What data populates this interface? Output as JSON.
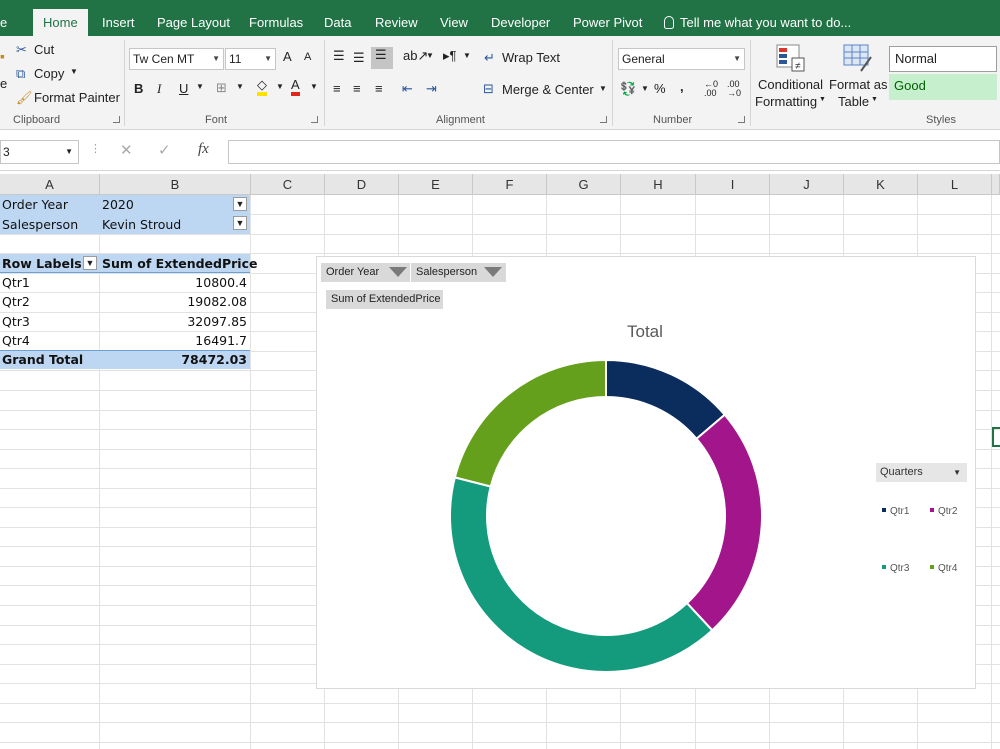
{
  "ribbon": {
    "tabs": [
      "e",
      "Home",
      "Insert",
      "Page Layout",
      "Formulas",
      "Data",
      "Review",
      "View",
      "Developer",
      "Power Pivot"
    ],
    "tell_me": "Tell me what you want to do...",
    "clipboard": {
      "cut": "Cut",
      "copy": "Copy",
      "format_painter": "Format Painter",
      "group": "Clipboard",
      "paste_fragment": "e"
    },
    "font": {
      "name": "Tw Cen MT",
      "size": "11",
      "bold": "B",
      "italic": "I",
      "underline": "U",
      "grow": "A",
      "shrink": "A",
      "font_color": "A",
      "group": "Font"
    },
    "alignment": {
      "wrap": "Wrap Text",
      "merge": "Merge & Center",
      "group": "Alignment"
    },
    "number": {
      "format": "General",
      "percent": "%",
      "comma": ",",
      "group": "Number"
    },
    "styles": {
      "conditional_l1": "Conditional",
      "conditional_l2": "Formatting",
      "format_table_l1": "Format as",
      "format_table_l2": "Table",
      "normal": "Normal",
      "good": "Good",
      "group": "Styles"
    }
  },
  "formula_bar": {
    "name_box": "3",
    "fx": "fx"
  },
  "columns": [
    "A",
    "B",
    "C",
    "D",
    "E",
    "F",
    "G",
    "H",
    "I",
    "J",
    "K",
    "L"
  ],
  "pivot": {
    "filters": [
      {
        "label": "Order Year",
        "value": "2020"
      },
      {
        "label": "Salesperson",
        "value": "Kevin Stroud"
      }
    ],
    "header_labels": "Row Labels",
    "header_sum": "Sum of ExtendedPrice",
    "rows": [
      {
        "label": "Qtr1",
        "value": "10800.4"
      },
      {
        "label": "Qtr2",
        "value": "19082.08"
      },
      {
        "label": "Qtr3",
        "value": "32097.85"
      },
      {
        "label": "Qtr4",
        "value": "16491.7"
      }
    ],
    "total_label": "Grand Total",
    "total_value": "78472.03"
  },
  "chart_buttons": {
    "order_year": "Order Year",
    "salesperson": "Salesperson",
    "sum_field": "Sum of ExtendedPrice",
    "legend_field": "Quarters"
  },
  "chart_data": {
    "type": "pie",
    "variant": "doughnut",
    "title": "Total",
    "categories": [
      "Qtr1",
      "Qtr2",
      "Qtr3",
      "Qtr4"
    ],
    "values": [
      10800.4,
      19082.08,
      32097.85,
      16491.7
    ],
    "colors": [
      "#0b2d5e",
      "#a3158b",
      "#149a7c",
      "#65a01c"
    ],
    "legend": "right"
  }
}
